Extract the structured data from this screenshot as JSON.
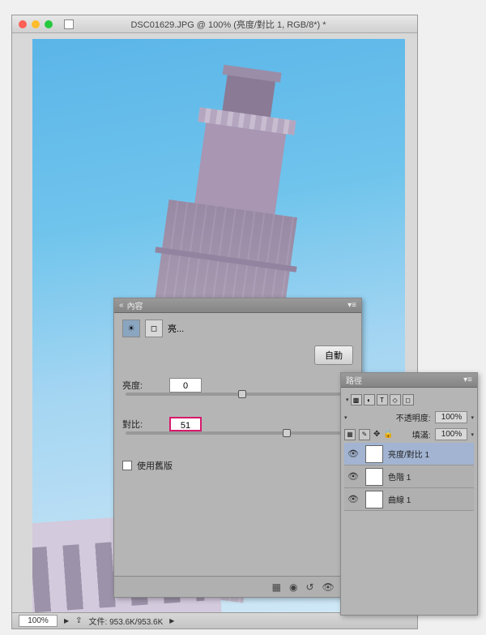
{
  "titlebar": {
    "title": "DSC01629.JPG @ 100% (亮度/對比 1, RGB/8*) *"
  },
  "properties_panel": {
    "header": "內容",
    "adjustment_name": "亮...",
    "auto_label": "自動",
    "brightness": {
      "label": "亮度:",
      "value": "0",
      "thumb_pct": 50
    },
    "contrast": {
      "label": "對比:",
      "value": "51",
      "thumb_pct": 70
    },
    "legacy_label": "使用舊版"
  },
  "layers_panel": {
    "header": "路徑",
    "opacity_label": "不透明度:",
    "opacity_value": "100%",
    "fill_label": "填滿:",
    "fill_value": "100%",
    "layers": [
      {
        "name": "亮度/對比 1",
        "selected": true
      },
      {
        "name": "色階 1",
        "selected": false
      },
      {
        "name": "曲線 1",
        "selected": false
      }
    ]
  },
  "statusbar": {
    "zoom": "100%",
    "file_info": "文件: 953.6K/953.6K"
  }
}
